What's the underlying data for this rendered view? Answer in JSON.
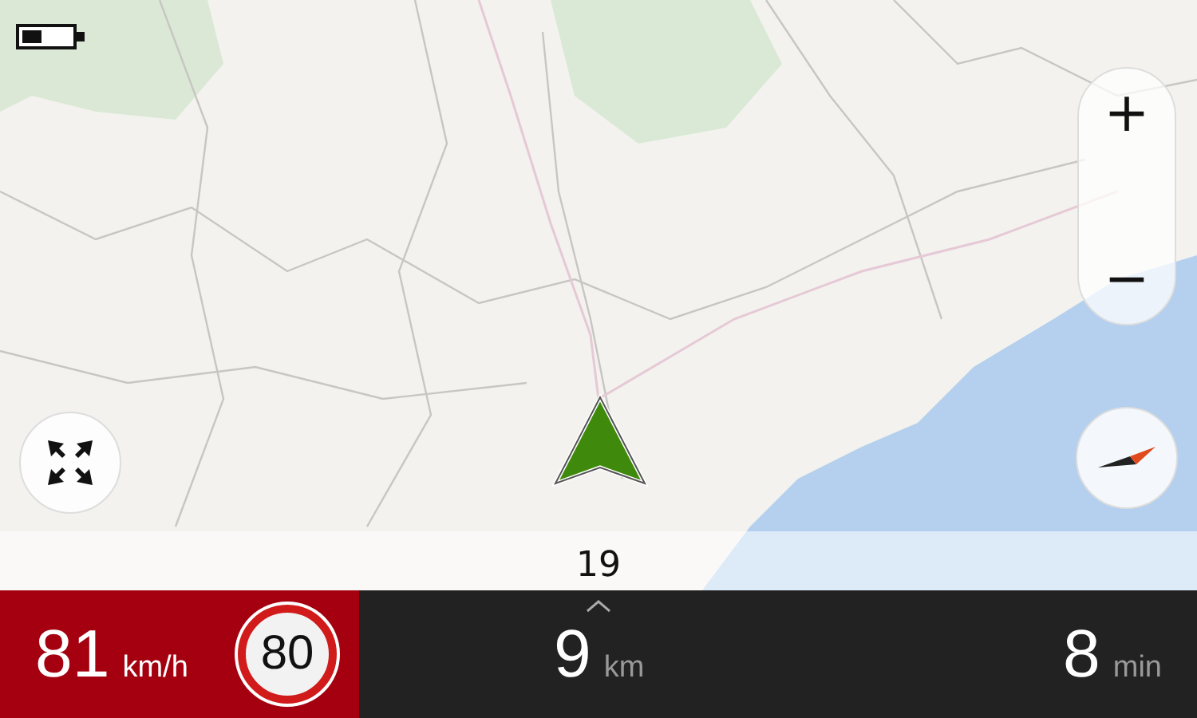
{
  "zoom": {
    "in_label": "+",
    "out_label": "−"
  },
  "road": {
    "name": "19"
  },
  "speed": {
    "value": "81",
    "unit": "km/h",
    "over_limit": true
  },
  "speed_limit": {
    "value": "80"
  },
  "distance": {
    "value": "9",
    "unit": "km"
  },
  "time": {
    "value": "8",
    "unit": "min"
  }
}
